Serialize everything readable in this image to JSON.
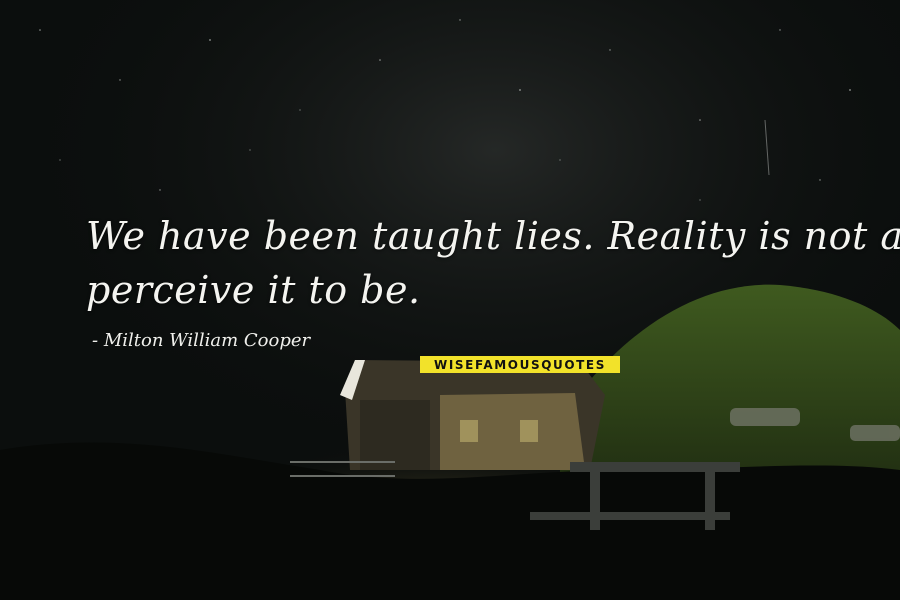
{
  "quote": {
    "line1": "We have been taught lies. Reality is not at all what we",
    "line2": "perceive it to be."
  },
  "author": "Milton William Cooper",
  "watermark": "WISEFAMOUSQUOTES",
  "colors": {
    "sky": "#0b0e0d",
    "text": "#f4f4f0",
    "badge": "#f2e22a"
  }
}
